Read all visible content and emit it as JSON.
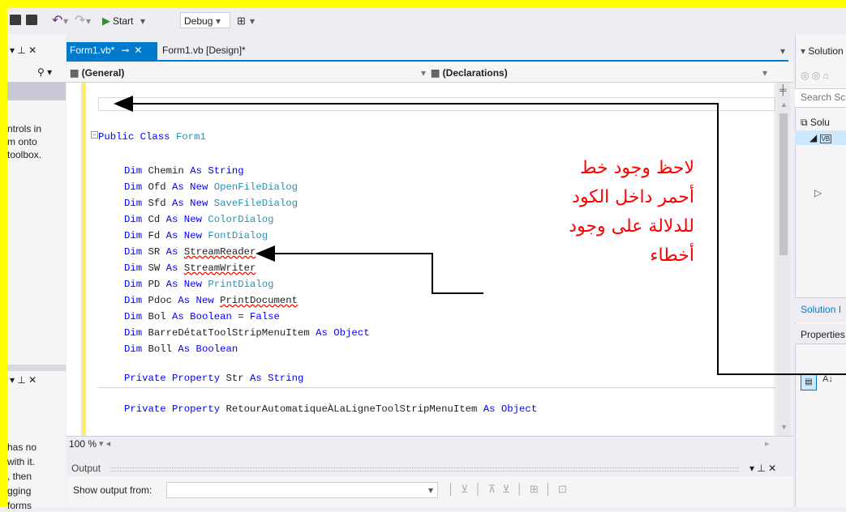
{
  "toolbar": {
    "start_label": "Start",
    "config_value": "Debug"
  },
  "tabs": [
    {
      "label": "Form1.vb*",
      "active": true
    },
    {
      "label": "Form1.vb [Design]*",
      "active": false
    }
  ],
  "navbar": {
    "left_dropdown": "(General)",
    "right_dropdown": "(Declarations)"
  },
  "code_lines": [
    "Public Class Form1",
    "Dim Chemin As String",
    "Dim Ofd As New OpenFileDialog",
    "Dim Sfd As New SaveFileDialog",
    "Dim Cd As New ColorDialog",
    "Dim Fd As New FontDialog",
    "Dim SR As StreamReader",
    "Dim SW As StreamWriter",
    "Dim PD As New PrintDialog",
    "Dim Pdoc As New PrintDocument",
    "Dim Bol As Boolean = False",
    "Dim BarreDétatToolStripMenuItem As Object",
    "Dim Boll As Boolean",
    "Private Property Str As String",
    "Private Property RetourAutomatiqueÀLaLigneToolStripMenuItem As Object"
  ],
  "zoom": "100 %",
  "output": {
    "title": "Output",
    "show_from_label": "Show output from:"
  },
  "left_panel": {
    "top_text": [
      "ntrols in",
      "m onto",
      "toolbox."
    ],
    "bottom_text": [
      "has no",
      "with it.",
      ", then",
      "gging",
      "forms"
    ]
  },
  "right_panel": {
    "title": "Solution E",
    "search": "Search Sc",
    "item1": "Solu",
    "solution_label": "Solution I",
    "properties_label": "Properties"
  },
  "annotation": {
    "lines": [
      "لاحظ وجود خط",
      "أحمر داخل الكود",
      "للدلالة على وجود",
      "أخطاء"
    ],
    "color": "#ff0000"
  },
  "colors": {
    "keyword": "#0000ff",
    "type": "#2b91af",
    "accent": "#007acc",
    "highlight": "#ffff00"
  }
}
